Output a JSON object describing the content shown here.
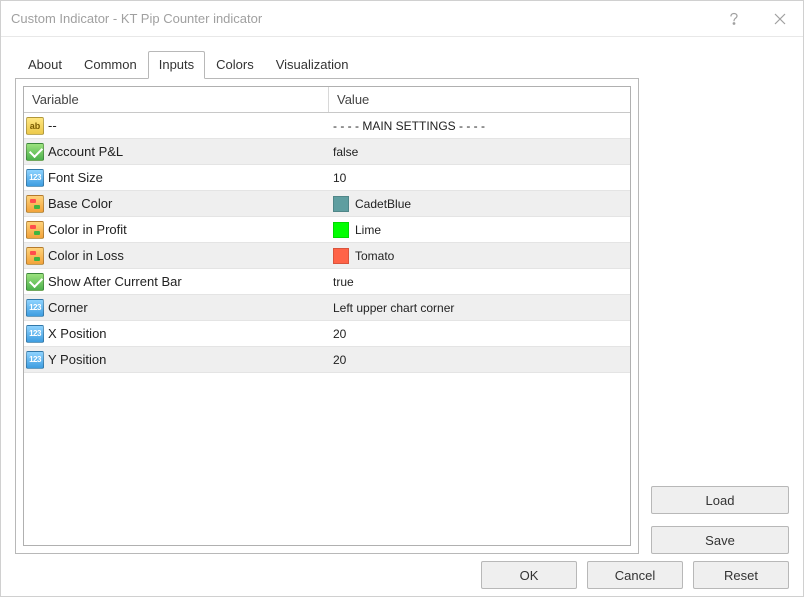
{
  "window": {
    "title": "Custom Indicator - KT Pip Counter indicator"
  },
  "tabs": [
    {
      "label": "About",
      "active": false
    },
    {
      "label": "Common",
      "active": false
    },
    {
      "label": "Inputs",
      "active": true
    },
    {
      "label": "Colors",
      "active": false
    },
    {
      "label": "Visualization",
      "active": false
    }
  ],
  "grid": {
    "header": {
      "variable": "Variable",
      "value": "Value"
    },
    "rows": [
      {
        "type": "string",
        "name": "--",
        "value": "- - - - MAIN SETTINGS - - - -"
      },
      {
        "type": "bool",
        "name": "Account P&L",
        "value": "false"
      },
      {
        "type": "int",
        "name": "Font Size",
        "value": "10"
      },
      {
        "type": "color",
        "name": "Base Color",
        "value": "CadetBlue",
        "swatch": "#5f9ea0"
      },
      {
        "type": "color",
        "name": "Color in Profit",
        "value": "Lime",
        "swatch": "#00ff00"
      },
      {
        "type": "color",
        "name": "Color in Loss",
        "value": "Tomato",
        "swatch": "#ff6347"
      },
      {
        "type": "bool",
        "name": "Show After Current Bar",
        "value": "true"
      },
      {
        "type": "int",
        "name": "Corner",
        "value": "Left upper chart corner"
      },
      {
        "type": "int",
        "name": "X Position",
        "value": "20"
      },
      {
        "type": "int",
        "name": "Y Position",
        "value": "20"
      }
    ]
  },
  "buttons": {
    "load": "Load",
    "save": "Save",
    "ok": "OK",
    "cancel": "Cancel",
    "reset": "Reset"
  }
}
